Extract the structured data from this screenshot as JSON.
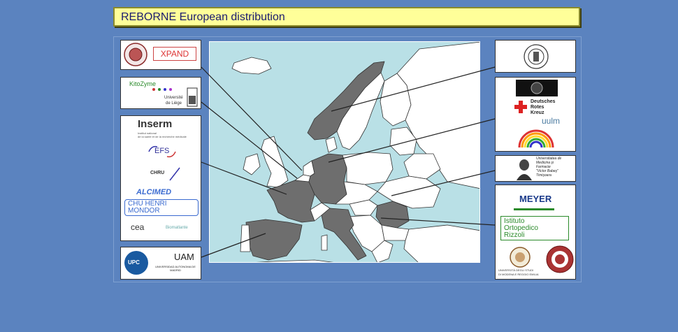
{
  "title": "REBORNE European distribution",
  "logos": {
    "xpand": "XPAND",
    "kitozyme": "KitoZyme",
    "ulg_line1": "Université",
    "ulg_line2": "de Liège",
    "inserm": "Inserm",
    "inserm_sub1": "Institut national",
    "inserm_sub2": "de la santé et de la recherche médicale",
    "efs": "EFS",
    "chru": "CHRU",
    "alcimed": "ALCIMED",
    "chu_line1": "CHU HENRI",
    "chu_line2": "MONDOR",
    "cea": "cea",
    "biomatlante": "Biomatlante",
    "upc": "UPC",
    "uam": "UAM",
    "uam_sub": "UNIVERSIDAD AUTONOMA DE MADRID",
    "drk_line1": "Deutsches",
    "drk_line2": "Rotes",
    "drk_line3": "Kreuz",
    "uulm": "uulm",
    "timisoara_line1": "Universitatea de",
    "timisoara_line2": "Medicina şi",
    "timisoara_line3": "Farmacie",
    "timisoara_line4": "\"Victor Babeş\"",
    "timisoara_line5": "Timişoara",
    "meyer": "MEYER",
    "ior_line1": "Istituto",
    "ior_line2": "Ortopedico",
    "ior_line3": "Rizzoli",
    "unimore_line1": "UNIVERSITÀ DEGLI STUDI",
    "unimore_line2": "DI MODENA E REGGIO EMILIA"
  },
  "colors": {
    "background": "#5b83bf",
    "title_fill": "#ffff99",
    "sea": "#b9e0e6",
    "partner_country": "#6e6e6e",
    "other_country": "#ffffff"
  }
}
